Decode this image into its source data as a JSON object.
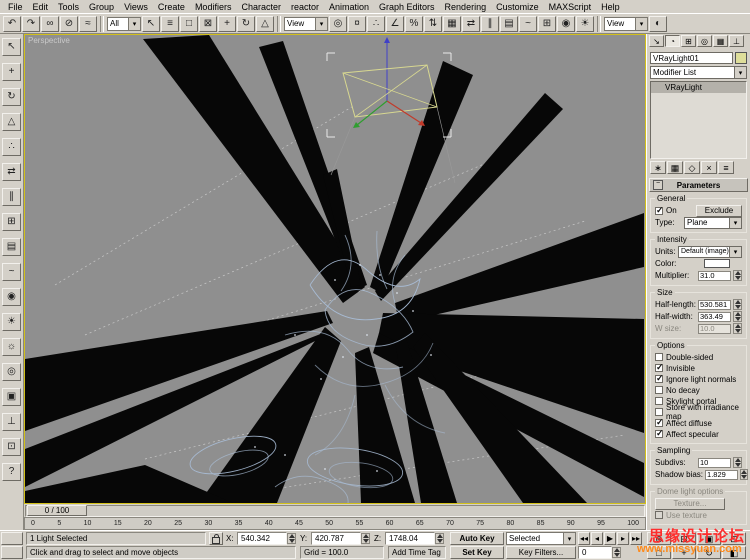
{
  "viewport": {
    "label": "Perspective"
  },
  "menu": {
    "items": [
      {
        "label": "File"
      },
      {
        "label": "Edit"
      },
      {
        "label": "Tools"
      },
      {
        "label": "Group"
      },
      {
        "label": "Views"
      },
      {
        "label": "Create"
      },
      {
        "label": "Modifiers"
      },
      {
        "label": "Character"
      },
      {
        "label": "reactor"
      },
      {
        "label": "Animation"
      },
      {
        "label": "Graph Editors"
      },
      {
        "label": "Rendering"
      },
      {
        "label": "Customize"
      },
      {
        "label": "MAXScript"
      },
      {
        "label": "Help"
      }
    ]
  },
  "toolbar": {
    "icons_a": [
      {
        "name": "undo-icon",
        "glyph": "↶"
      },
      {
        "name": "redo-icon",
        "glyph": "↷"
      },
      {
        "name": "select-and-link-icon",
        "glyph": "∞"
      },
      {
        "name": "unlink-selection-icon",
        "glyph": "⊘"
      },
      {
        "name": "bind-to-spacewarp-icon",
        "glyph": "≈"
      }
    ],
    "filter_value": "All",
    "icons_b": [
      {
        "name": "select-object-icon",
        "glyph": "↖"
      },
      {
        "name": "select-by-name-icon",
        "glyph": "≡"
      },
      {
        "name": "rectangular-selection-icon",
        "glyph": "□"
      },
      {
        "name": "window-crossing-icon",
        "glyph": "⊠"
      },
      {
        "name": "select-and-move-icon",
        "glyph": "+"
      },
      {
        "name": "select-and-rotate-icon",
        "glyph": "↻"
      },
      {
        "name": "select-and-scale-icon",
        "glyph": "△"
      }
    ],
    "coord_value": "View",
    "icons_c": [
      {
        "name": "use-pivot-center-icon",
        "glyph": "◎"
      },
      {
        "name": "select-and-manipulate-icon",
        "glyph": "¤"
      },
      {
        "name": "snap-toggle-icon",
        "glyph": "∴"
      },
      {
        "name": "angle-snap-icon",
        "glyph": "∠"
      },
      {
        "name": "percent-snap-icon",
        "glyph": "%"
      },
      {
        "name": "spinner-snap-icon",
        "glyph": "⇅"
      },
      {
        "name": "named-selection-sets-icon",
        "glyph": "▦"
      },
      {
        "name": "mirror-icon",
        "glyph": "⇄"
      },
      {
        "name": "align-icon",
        "glyph": "∥"
      },
      {
        "name": "layer-manager-icon",
        "glyph": "▤"
      },
      {
        "name": "curve-editor-icon",
        "glyph": "~"
      },
      {
        "name": "schematic-view-icon",
        "glyph": "⊞"
      },
      {
        "name": "material-editor-icon",
        "glyph": "◉"
      },
      {
        "name": "render-scene-icon",
        "glyph": "☀"
      }
    ],
    "render_type_value": "View",
    "icons_d": [
      {
        "name": "quick-render-icon",
        "glyph": "◐"
      }
    ]
  },
  "left_toolbar": {
    "icons": [
      {
        "name": "select-tool-icon",
        "glyph": "↖"
      },
      {
        "name": "move-tool-icon",
        "glyph": "+"
      },
      {
        "name": "rotate-tool-icon",
        "glyph": "↻"
      },
      {
        "name": "scale-tool-icon",
        "glyph": "△"
      },
      {
        "name": "snap-tool-icon",
        "glyph": "∴"
      },
      {
        "name": "mirror-tool-icon",
        "glyph": "⇄"
      },
      {
        "name": "align-tool-icon",
        "glyph": "∥"
      },
      {
        "name": "array-tool-icon",
        "glyph": "⊞"
      },
      {
        "name": "layers-tool-icon",
        "glyph": "▤"
      },
      {
        "name": "curve-editor-tool-icon",
        "glyph": "~"
      },
      {
        "name": "material-editor-tool-icon",
        "glyph": "◉"
      },
      {
        "name": "render-tool-icon",
        "glyph": "☀"
      },
      {
        "name": "light-tool-icon",
        "glyph": "☼"
      },
      {
        "name": "camera-tool-icon",
        "glyph": "◎"
      },
      {
        "name": "display-tool-icon",
        "glyph": "▣"
      },
      {
        "name": "utilities-tool-icon",
        "glyph": "⊥"
      },
      {
        "name": "lock-tool-icon",
        "glyph": "⊡"
      },
      {
        "name": "help-tool-icon",
        "glyph": "?"
      }
    ]
  },
  "timeline": {
    "slider_label": "0 / 100",
    "ticks": [
      "0",
      "5",
      "10",
      "15",
      "20",
      "25",
      "30",
      "35",
      "40",
      "45",
      "50",
      "55",
      "60",
      "65",
      "70",
      "75",
      "80",
      "85",
      "90",
      "95",
      "100"
    ]
  },
  "status": {
    "selection": "1 Light Selected",
    "prompt": "Click and drag to select and move objects",
    "x_label": "X:",
    "x_value": "540.342",
    "y_label": "Y:",
    "y_value": "420.787",
    "z_label": "Z:",
    "z_value": "1748.04",
    "grid": "Grid = 100.0",
    "add_time_tag": "Add Time Tag",
    "auto_key": "Auto Key",
    "selected_combo": "Selected",
    "set_key": "Set Key",
    "key_filters": "Key Filters...",
    "time_value": "0",
    "transport": [
      {
        "name": "go-to-start-button",
        "glyph": "◂◂"
      },
      {
        "name": "previous-frame-button",
        "glyph": "◂"
      },
      {
        "name": "play-button",
        "glyph": "▶"
      },
      {
        "name": "next-frame-button",
        "glyph": "▸"
      },
      {
        "name": "go-to-end-button",
        "glyph": "▸▸"
      }
    ]
  },
  "nav": {
    "buttons": [
      {
        "name": "zoom-icon",
        "glyph": "⊕"
      },
      {
        "name": "zoom-all-icon",
        "glyph": "⊞"
      },
      {
        "name": "zoom-extents-icon",
        "glyph": "▣"
      },
      {
        "name": "zoom-extents-all-icon",
        "glyph": "⊡"
      },
      {
        "name": "zoom-region-icon",
        "glyph": "□"
      },
      {
        "name": "pan-icon",
        "glyph": "+"
      },
      {
        "name": "arc-rotate-icon",
        "glyph": "↻"
      },
      {
        "name": "min-max-toggle-icon",
        "glyph": "◧"
      }
    ]
  },
  "panel": {
    "tabs": [
      {
        "name": "tab-create",
        "glyph": "↘"
      },
      {
        "name": "tab-modify",
        "glyph": "◔",
        "active": true
      },
      {
        "name": "tab-hierarchy",
        "glyph": "⊞"
      },
      {
        "name": "tab-motion",
        "glyph": "◎"
      },
      {
        "name": "tab-display",
        "glyph": "▦"
      },
      {
        "name": "tab-utilities",
        "glyph": "⊥"
      }
    ],
    "object_name": "VRayLight01",
    "modifier_list_label": "Modifier List",
    "stack_items": [
      {
        "label": "VRayLight",
        "selected": true
      }
    ],
    "stack_tools": [
      {
        "name": "pin-stack-icon",
        "glyph": "∗"
      },
      {
        "name": "show-end-result-icon",
        "glyph": "▦"
      },
      {
        "name": "make-unique-icon",
        "glyph": "◇"
      },
      {
        "name": "remove-modifier-icon",
        "glyph": "×"
      },
      {
        "name": "configure-modifier-sets-icon",
        "glyph": "≡"
      }
    ],
    "rollout_label": "Parameters",
    "general": {
      "title": "General",
      "on_label": "On",
      "on_checked": true,
      "exclude_label": "Exclude",
      "type_label": "Type:",
      "type_value": "Plane"
    },
    "intensity": {
      "title": "Intensity",
      "units_label": "Units:",
      "units_value": "Default (image)",
      "color_label": "Color:",
      "multiplier_label": "Multiplier:",
      "multiplier_value": "31.0"
    },
    "size": {
      "title": "Size",
      "rows": [
        {
          "label": "Half-length:",
          "value": "530.581"
        },
        {
          "label": "Half-width:",
          "value": "363.49"
        },
        {
          "label": "W size:",
          "value": "10.0",
          "disabled": true
        }
      ]
    },
    "options": {
      "title": "Options",
      "rows": [
        {
          "label": "Double-sided"
        },
        {
          "label": "Invisible",
          "checked": true
        },
        {
          "label": "Ignore light normals",
          "checked": true
        },
        {
          "label": "No decay"
        },
        {
          "label": "Skylight portal"
        },
        {
          "label": "Store with irradiance map"
        },
        {
          "label": "Affect diffuse",
          "checked": true
        },
        {
          "label": "Affect specular",
          "checked": true
        }
      ]
    },
    "sampling": {
      "title": "Sampling",
      "rows": [
        {
          "label": "Subdivs:",
          "value": "10"
        },
        {
          "label": "Shadow bias:",
          "value": "1.829"
        }
      ]
    },
    "dome": {
      "title": "Dome light options",
      "texture_label": "Texture...",
      "use_texture_label": "Use texture"
    }
  },
  "watermark": {
    "line1": "思缘设计论坛",
    "line2": "www.missyuan.com"
  },
  "colors": {
    "viewport_border": "#d2c01a",
    "viewport_bg": "#8f8f8f",
    "wireframe": "#a9bdd6",
    "watermark_red": "#ff2d2d",
    "watermark_orange": "#ff8a1a"
  }
}
